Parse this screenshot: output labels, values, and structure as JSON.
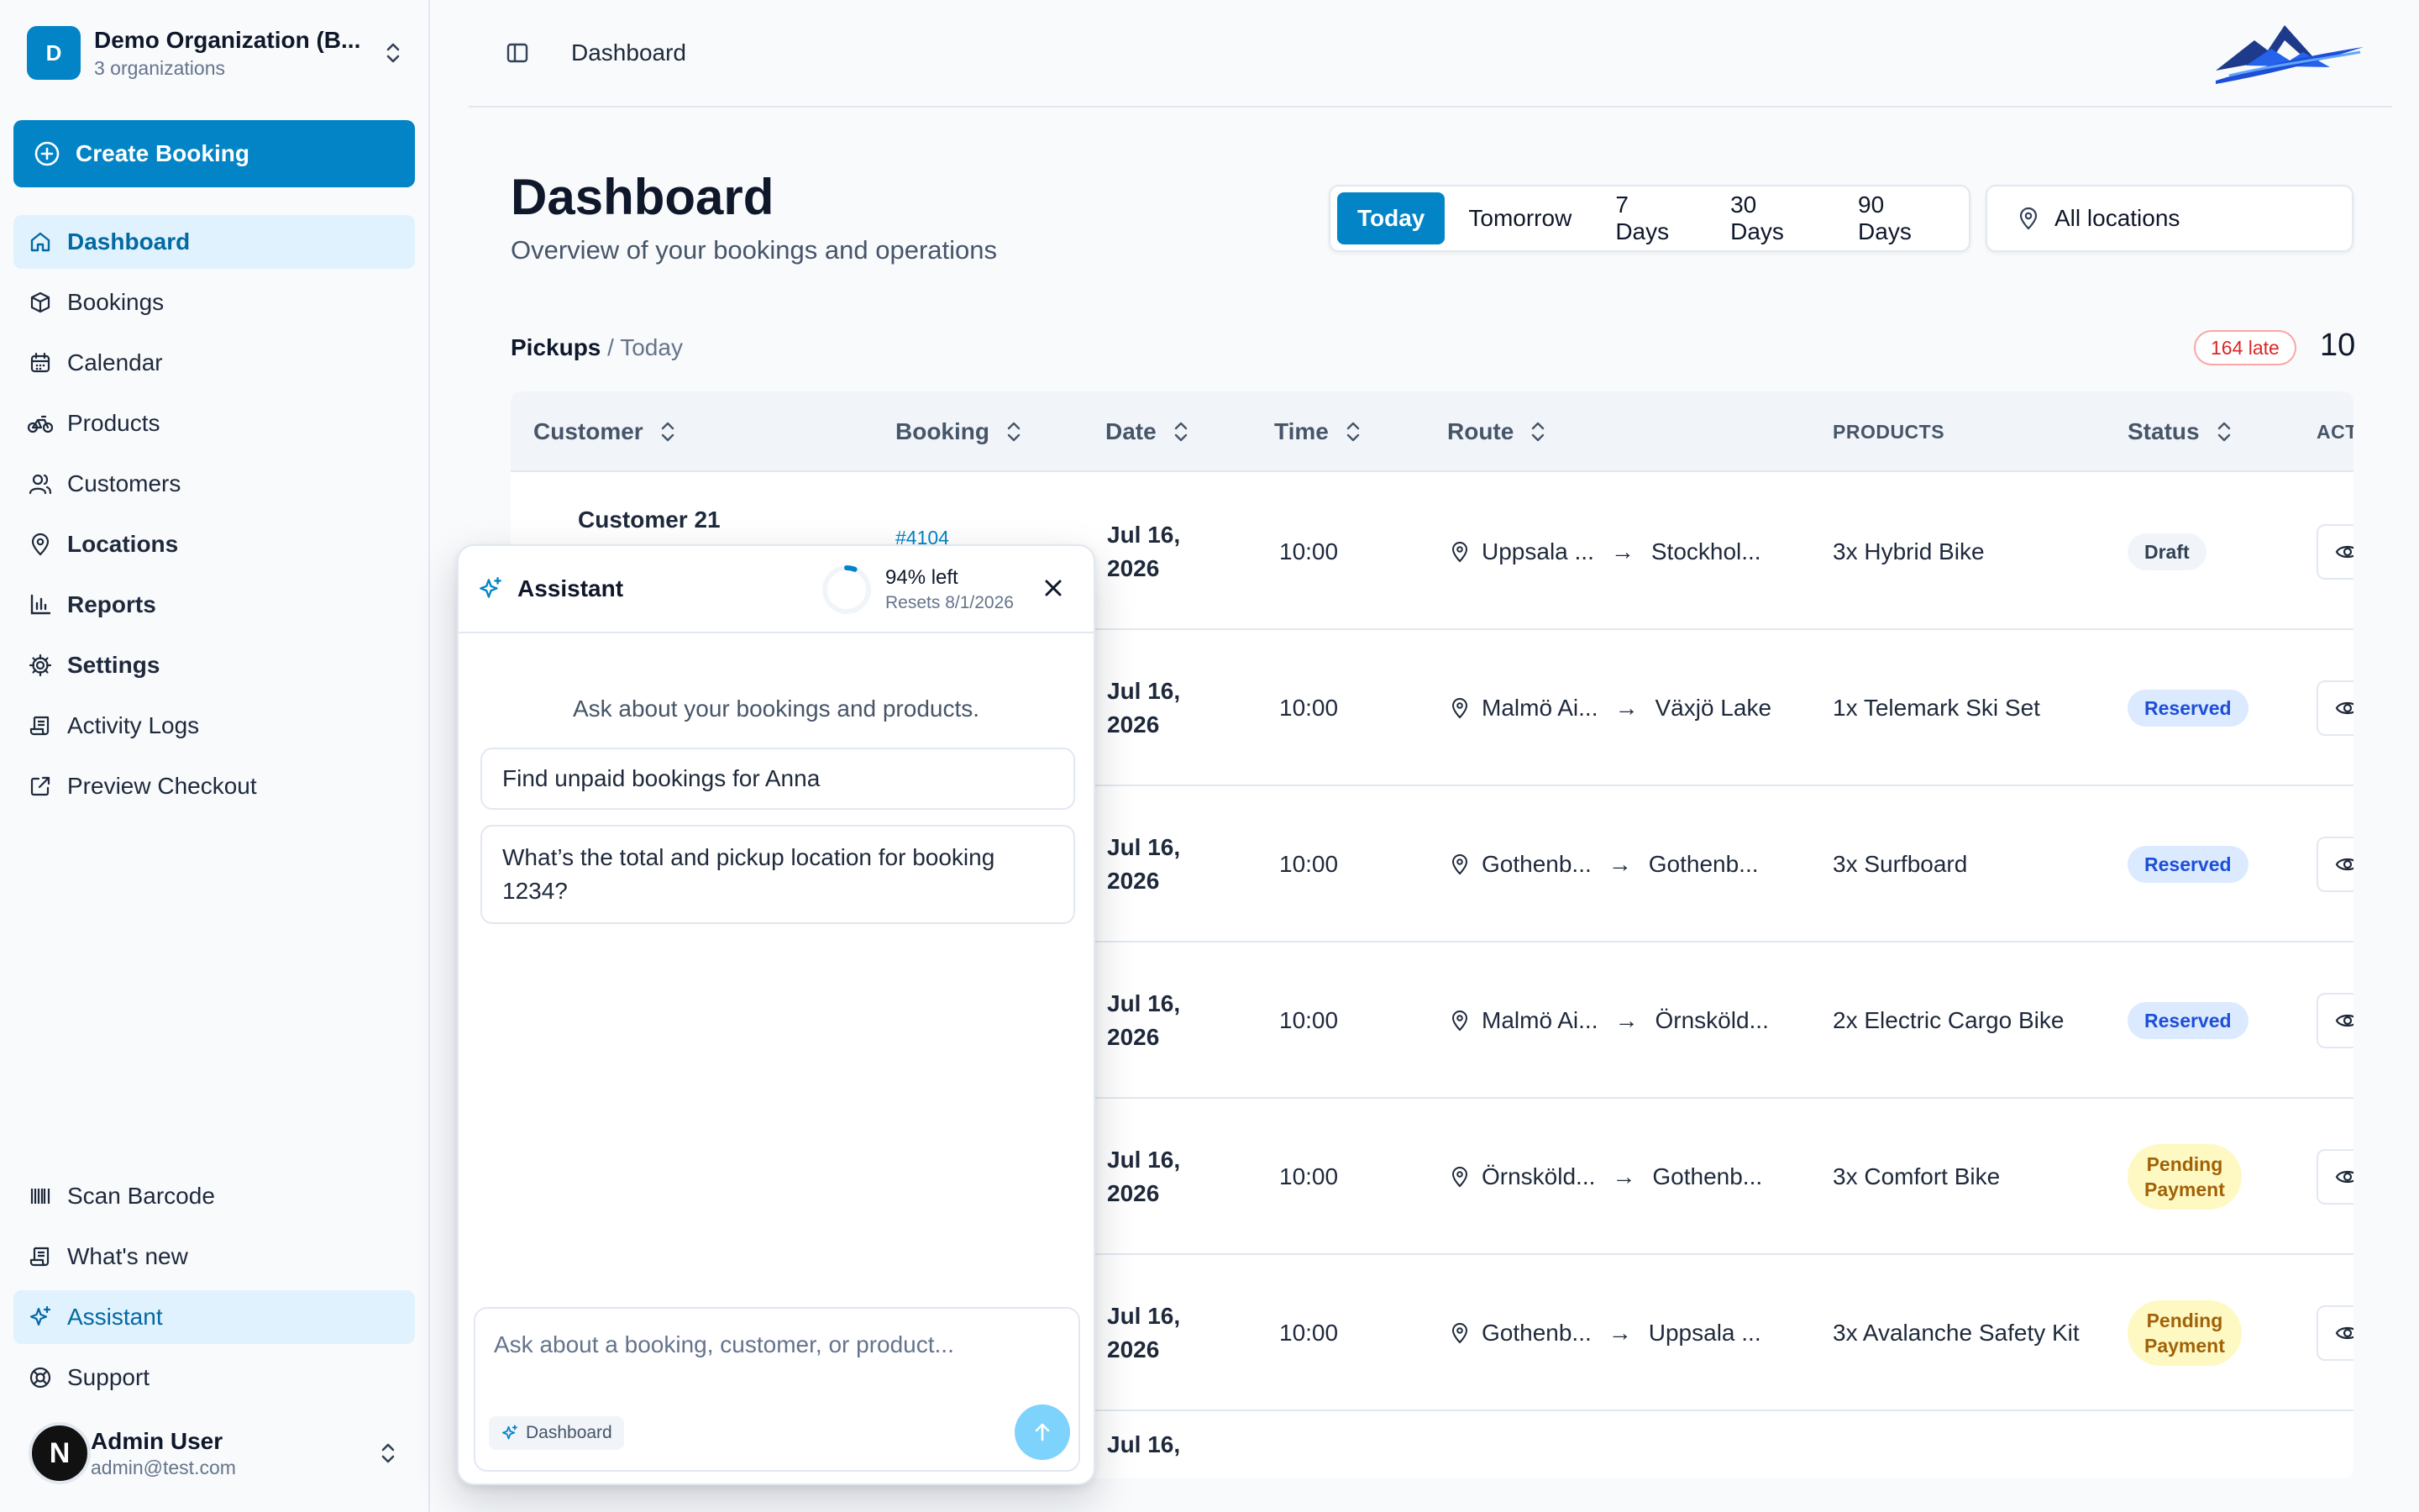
{
  "org": {
    "avatar": "D",
    "name": "Demo Organization (B...",
    "subtitle": "3 organizations"
  },
  "create_booking_label": "Create Booking",
  "nav": [
    {
      "label": "Dashboard",
      "icon": "home-icon",
      "active": true
    },
    {
      "label": "Bookings",
      "icon": "box-icon"
    },
    {
      "label": "Calendar",
      "icon": "calendar-icon"
    },
    {
      "label": "Products",
      "icon": "bike-icon"
    },
    {
      "label": "Customers",
      "icon": "users-icon"
    },
    {
      "label": "Locations",
      "icon": "map-pin-icon"
    },
    {
      "label": "Reports",
      "icon": "bar-chart-icon"
    },
    {
      "label": "Settings",
      "icon": "gear-icon"
    },
    {
      "label": "Activity Logs",
      "icon": "scroll-icon"
    },
    {
      "label": "Preview Checkout",
      "icon": "external-link-icon"
    }
  ],
  "nav_bottom": [
    {
      "label": "Scan Barcode",
      "icon": "barcode-icon"
    },
    {
      "label": "What's new",
      "icon": "scroll-icon"
    },
    {
      "label": "Assistant",
      "icon": "sparkles-icon",
      "active": true
    },
    {
      "label": "Support",
      "icon": "life-buoy-icon"
    }
  ],
  "user": {
    "avatar": "N",
    "name": "Admin User",
    "email": "admin@test.com"
  },
  "topbar": {
    "breadcrumb": "Dashboard"
  },
  "page": {
    "title": "Dashboard",
    "subtitle": "Overview of your bookings and operations"
  },
  "ranges": [
    "Today",
    "Tomorrow",
    "7 Days",
    "30 Days",
    "90 Days"
  ],
  "active_range": "Today",
  "location_filter": "All locations",
  "section": {
    "title": "Pickups",
    "separator": "/",
    "range": "Today",
    "late_badge": "164 late",
    "count": "10"
  },
  "table": {
    "headers": {
      "customer": "Customer",
      "booking": "Booking",
      "date": "Date",
      "time": "Time",
      "route": "Route",
      "products": "PRODUCTS",
      "status": "Status",
      "actions": "ACT"
    },
    "rows": [
      {
        "customer": "Customer 21",
        "booking": "#4104",
        "date_line1": "Jul 16,",
        "date_line2": "2026",
        "time": "10:00",
        "from": "Uppsala ...",
        "to": "Stockhol...",
        "products": "3x Hybrid Bike",
        "status": "Draft",
        "status_kind": "draft"
      },
      {
        "customer": "",
        "booking": "",
        "date_line1": "Jul 16,",
        "date_line2": "2026",
        "time": "10:00",
        "from": "Malmö Ai...",
        "to": "Växjö Lake",
        "products": "1x Telemark Ski Set",
        "status": "Reserved",
        "status_kind": "reserved"
      },
      {
        "customer": "",
        "booking": "",
        "date_line1": "Jul 16,",
        "date_line2": "2026",
        "time": "10:00",
        "from": "Gothenb...",
        "to": "Gothenb...",
        "products": "3x Surfboard",
        "status": "Reserved",
        "status_kind": "reserved"
      },
      {
        "customer": "",
        "booking": "",
        "date_line1": "Jul 16,",
        "date_line2": "2026",
        "time": "10:00",
        "from": "Malmö Ai...",
        "to": "Örnsköld...",
        "products": "2x Electric Cargo Bike",
        "status": "Reserved",
        "status_kind": "reserved"
      },
      {
        "customer": "",
        "booking": "",
        "date_line1": "Jul 16,",
        "date_line2": "2026",
        "time": "10:00",
        "from": "Örnsköld...",
        "to": "Gothenb...",
        "products": "3x Comfort Bike",
        "status_line1": "Pending",
        "status_line2": "Payment",
        "status_kind": "pending"
      },
      {
        "customer": "",
        "booking": "",
        "date_line1": "Jul 16,",
        "date_line2": "2026",
        "time": "10:00",
        "from": "Gothenb...",
        "to": "Uppsala ...",
        "products": "3x Avalanche Safety Kit",
        "status_line1": "Pending",
        "status_line2": "Payment",
        "status_kind": "pending"
      },
      {
        "customer": "",
        "booking": "",
        "date_line1": "Jul 16,",
        "date_line2": "",
        "time": "",
        "from": "",
        "to": "",
        "products": "",
        "status": "",
        "status_kind": "reserved"
      }
    ]
  },
  "assistant": {
    "title": "Assistant",
    "quota_left": "94% left",
    "quota_fraction": 0.94,
    "quota_reset": "Resets 8/1/2026",
    "hint": "Ask about your bookings and products.",
    "suggestions": [
      "Find unpaid bookings for Anna",
      "What’s the total and pickup location for booking 1234?"
    ],
    "input_placeholder": "Ask about a booking, customer, or product...",
    "context_chip": "Dashboard"
  },
  "colors": {
    "brand": "#0284c7",
    "active_bg": "#e0f2fe",
    "danger": "#dc2626"
  }
}
